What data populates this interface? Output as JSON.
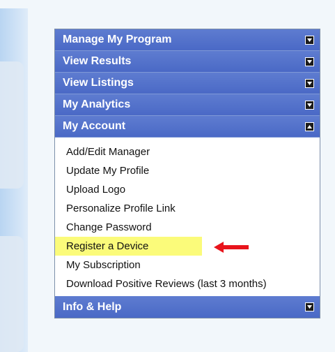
{
  "menu": {
    "sections": [
      {
        "label": "Manage My Program",
        "expanded": false
      },
      {
        "label": "View Results",
        "expanded": false
      },
      {
        "label": "View Listings",
        "expanded": false
      },
      {
        "label": "My Analytics",
        "expanded": false
      },
      {
        "label": "My Account",
        "expanded": true
      }
    ],
    "account_items": [
      "Add/Edit Manager",
      "Update My Profile",
      "Upload Logo",
      "Personalize Profile Link",
      "Change Password",
      "Register a Device",
      "My Subscription",
      "Download Positive Reviews (last 3 months)"
    ],
    "bottom_section": {
      "label": "Info & Help",
      "expanded": false
    },
    "highlighted_item": "Register a Device"
  },
  "colors": {
    "header_bg": "#4a69c6",
    "highlight": "#fbfb7a",
    "arrow": "#e8141c"
  },
  "icons": {
    "collapsed": "chevron-down-icon",
    "expanded": "chevron-up-icon",
    "pointer": "red-arrow-icon"
  }
}
